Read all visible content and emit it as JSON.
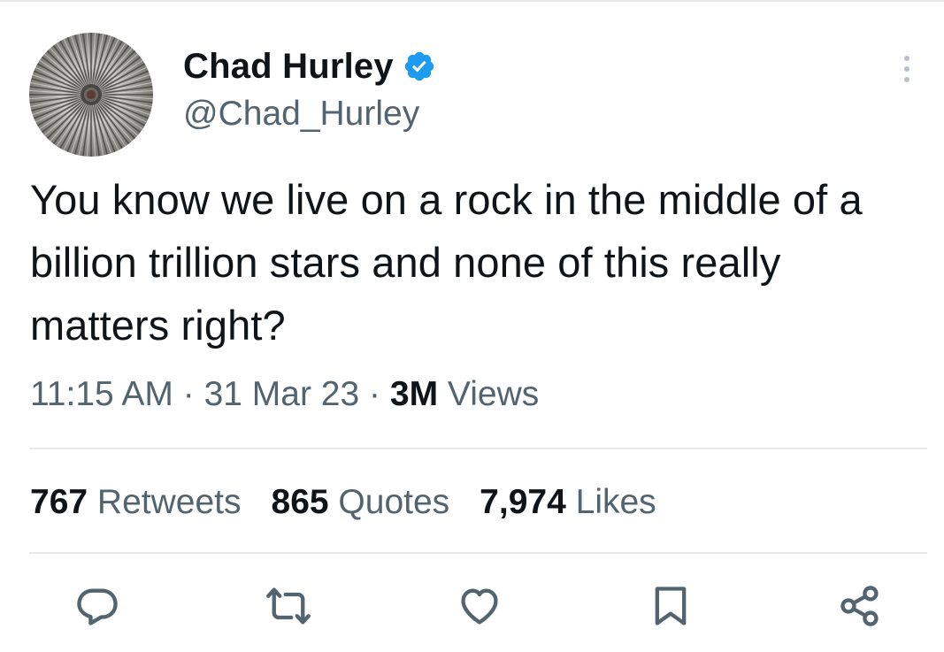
{
  "author": {
    "display_name": "Chad Hurley",
    "handle": "@Chad_Hurley",
    "verified": true,
    "avatar_icon": "radial-spikes-avatar"
  },
  "tweet": {
    "text": "You know we live on a rock in the middle of a billion trillion stars and none of this really matters right?"
  },
  "meta": {
    "time": "11:15 AM",
    "separator": "·",
    "date": "31 Mar 23",
    "views_count": "3M",
    "views_label": "Views"
  },
  "stats": {
    "retweets_count": "767",
    "retweets_label": "Retweets",
    "quotes_count": "865",
    "quotes_label": "Quotes",
    "likes_count": "7,974",
    "likes_label": "Likes"
  },
  "actions": [
    {
      "icon": "reply-icon"
    },
    {
      "icon": "retweet-icon"
    },
    {
      "icon": "like-icon"
    },
    {
      "icon": "bookmark-icon"
    },
    {
      "icon": "share-icon"
    }
  ],
  "colors": {
    "text": "#0f1419",
    "secondary": "#536471",
    "verified": "#1d9bf0",
    "divider": "#e6eaed"
  }
}
